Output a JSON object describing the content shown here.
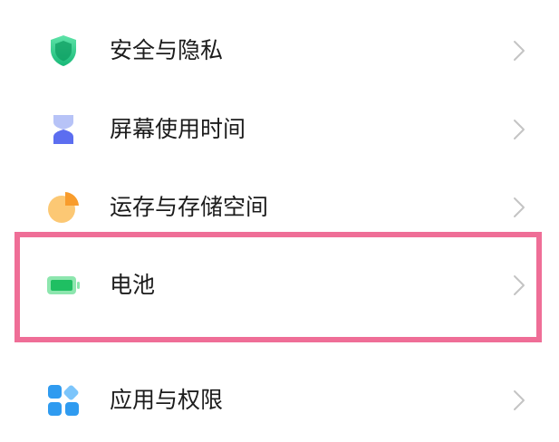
{
  "settings": {
    "items": [
      {
        "label": "安全与隐私",
        "icon": "shield-icon"
      },
      {
        "label": "屏幕使用时间",
        "icon": "hourglass-icon"
      },
      {
        "label": "运存与存储空间",
        "icon": "pie-chart-icon"
      },
      {
        "label": "电池",
        "icon": "battery-icon"
      },
      {
        "label": "应用与权限",
        "icon": "apps-grid-icon"
      }
    ]
  },
  "highlight": {
    "target": "电池",
    "color": "#ef6e97"
  },
  "colors": {
    "shield": "#2fcc8a",
    "hourglass": "#5c6ef0",
    "pie": "#fbb04a",
    "battery": "#26c66a",
    "apps": "#2f9bf0",
    "chevron": "#c4c4c4"
  }
}
